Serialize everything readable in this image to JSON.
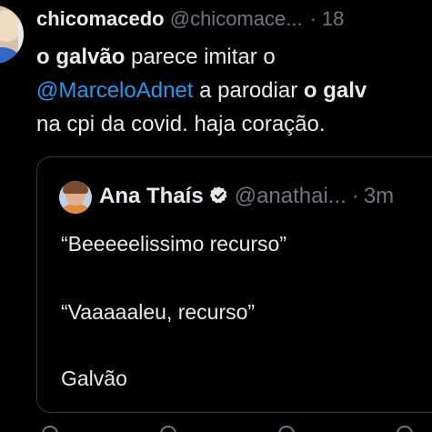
{
  "tweet": {
    "author_name": "chicomacedo",
    "author_handle": "@chicomace...",
    "separator": "·",
    "timestamp": "18",
    "text": {
      "line1_bold": "o galvão",
      "line1_rest": " parece imitar o",
      "line2_mention": "@MarceloAdnet",
      "line2_rest": " a parodiar ",
      "line2_bold": "o galv",
      "line3": "na cpi da covid. haja coração."
    }
  },
  "quoted_tweet": {
    "author_name": "Ana Thaís",
    "verified": true,
    "author_handle": "@anathai...",
    "separator": "·",
    "timestamp": "3m",
    "lines": [
      "“Beeeeelissimo recurso”",
      "“Vaaaaaleu, recurso”",
      "Galvão"
    ]
  },
  "colors": {
    "background": "#000000",
    "text": "#e7e9ea",
    "secondary": "#71767b",
    "accent": "#1d9bf0",
    "border": "#333639"
  },
  "icons": {
    "verified": "verified-badge-icon"
  }
}
